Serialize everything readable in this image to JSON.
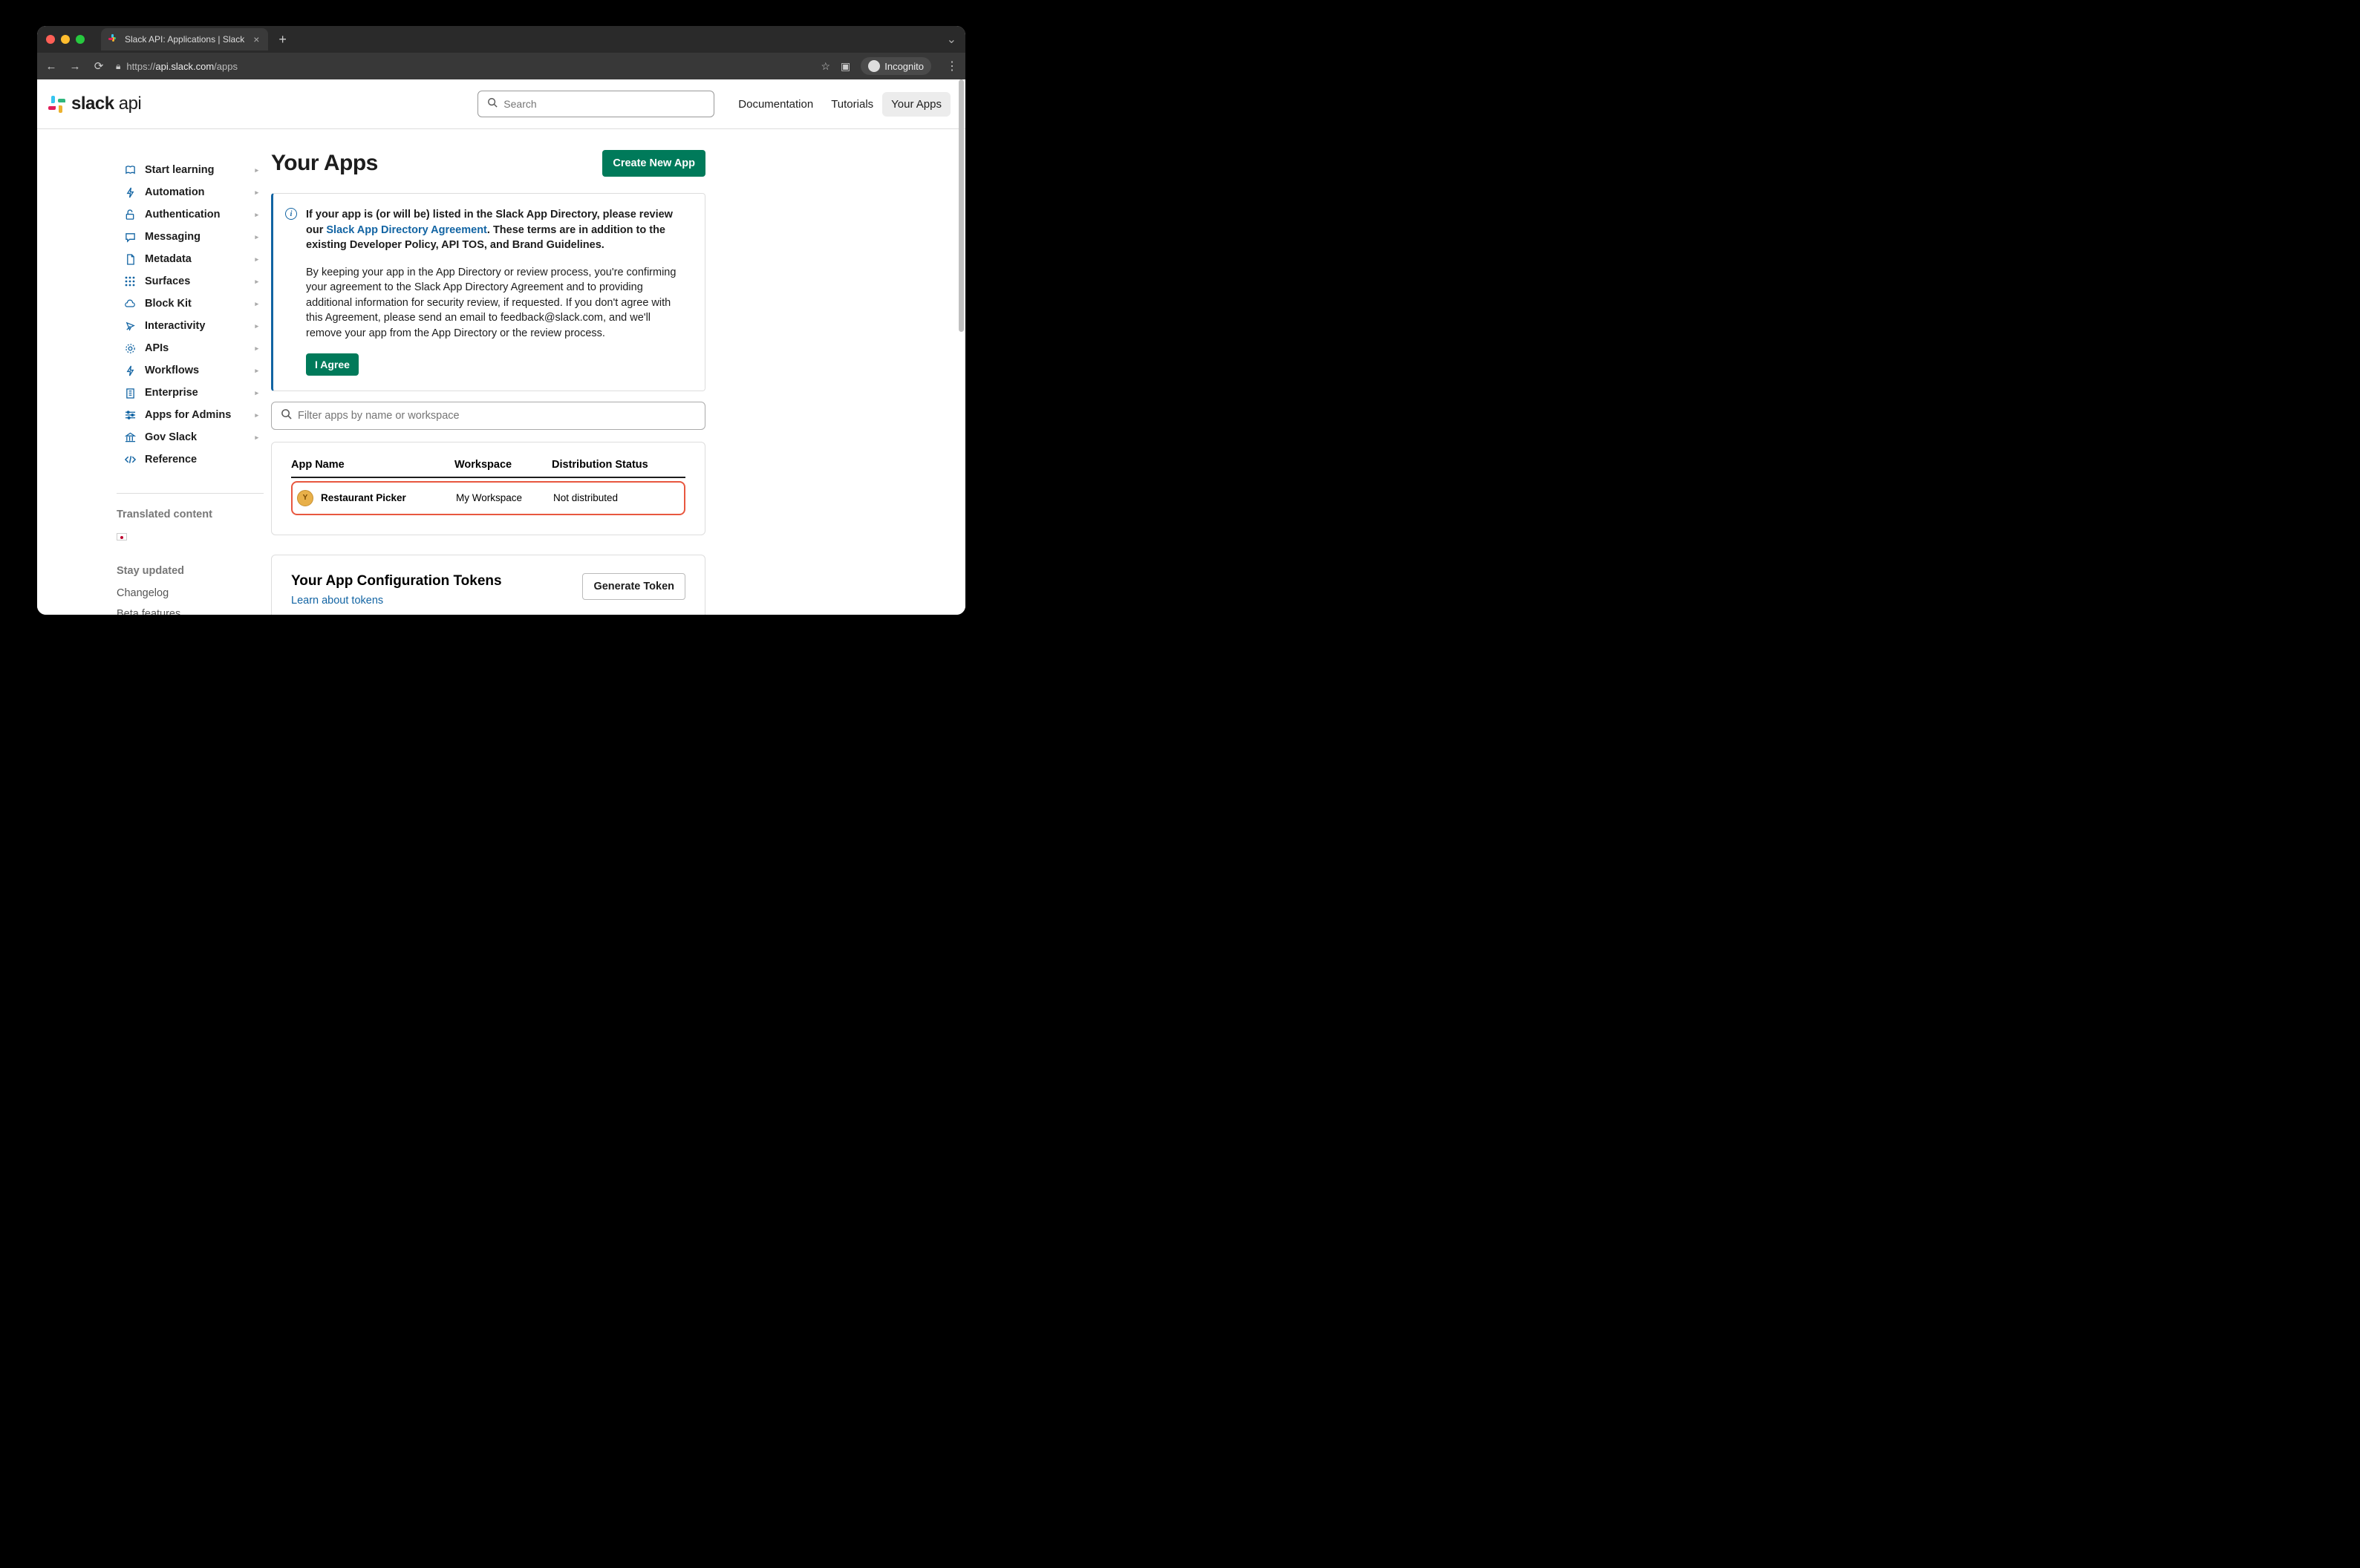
{
  "browser": {
    "tab_title": "Slack API: Applications | Slack",
    "url_prefix": "https://",
    "url_domain": "api.slack.com",
    "url_path": "/apps",
    "incognito_label": "Incognito"
  },
  "brand": {
    "bold": "slack",
    "thin": " api"
  },
  "search": {
    "placeholder": "Search"
  },
  "topnav": {
    "documentation": "Documentation",
    "tutorials": "Tutorials",
    "your_apps": "Your Apps"
  },
  "sidebar": {
    "items": [
      {
        "label": "Start learning",
        "icon": "book"
      },
      {
        "label": "Automation",
        "icon": "bolt"
      },
      {
        "label": "Authentication",
        "icon": "lock"
      },
      {
        "label": "Messaging",
        "icon": "message"
      },
      {
        "label": "Metadata",
        "icon": "file"
      },
      {
        "label": "Surfaces",
        "icon": "grid"
      },
      {
        "label": "Block Kit",
        "icon": "cloud"
      },
      {
        "label": "Interactivity",
        "icon": "cursor"
      },
      {
        "label": "APIs",
        "icon": "gear"
      },
      {
        "label": "Workflows",
        "icon": "bolt"
      },
      {
        "label": "Enterprise",
        "icon": "building"
      },
      {
        "label": "Apps for Admins",
        "icon": "sliders"
      },
      {
        "label": "Gov Slack",
        "icon": "gov"
      },
      {
        "label": "Reference",
        "icon": "code"
      }
    ],
    "translated_heading": "Translated content",
    "stay_updated_heading": "Stay updated",
    "links": [
      "Changelog",
      "Beta features"
    ]
  },
  "main": {
    "title": "Your Apps",
    "create_btn": "Create New App",
    "notice": {
      "p1_a": "If your app is (or will be) listed in the Slack App Directory, please review our ",
      "p1_link": "Slack App Directory Agreement",
      "p1_b": ". These terms are in addition to the existing Developer Policy, API TOS, and Brand Guidelines.",
      "p2": "By keeping your app in the App Directory or review process, you're confirming your agreement to the Slack App Directory Agreement and to providing additional information for security review, if requested. If you don't agree with this Agreement, please send an email to feedback@slack.com, and we'll remove your app from the App Directory or the review process.",
      "agree_btn": "I Agree"
    },
    "filter_placeholder": "Filter apps by name or workspace",
    "table": {
      "h1": "App Name",
      "h2": "Workspace",
      "h3": "Distribution Status",
      "rows": [
        {
          "name": "Restaurant Picker",
          "workspace": "My Workspace",
          "status": "Not distributed",
          "icon_letter": "Y"
        }
      ]
    },
    "tokens": {
      "title": "Your App Configuration Tokens",
      "link": "Learn about tokens",
      "btn": "Generate Token"
    }
  }
}
